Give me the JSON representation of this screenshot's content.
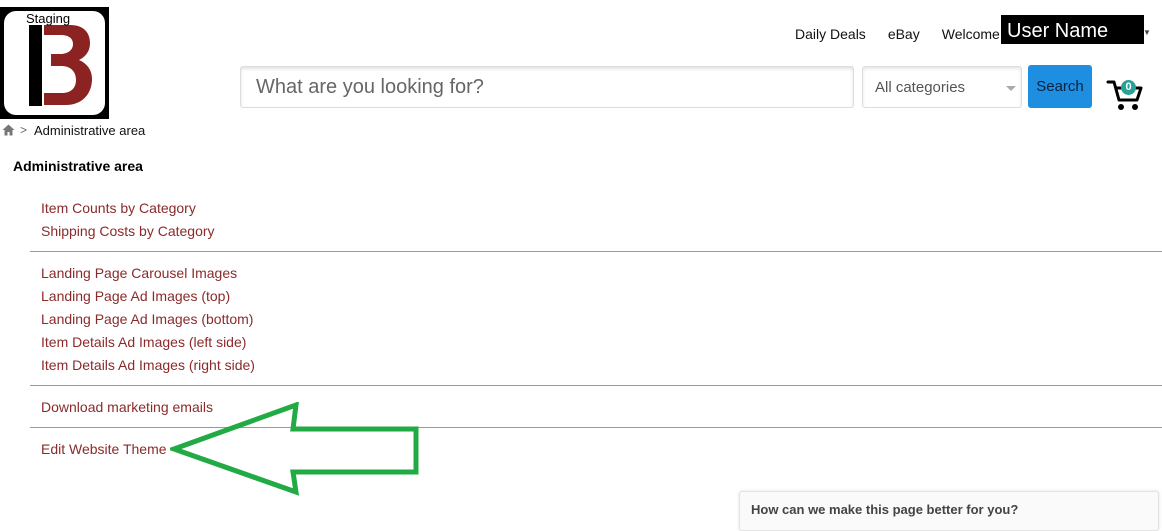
{
  "logo": {
    "badge": "Staging",
    "icon": "brand-logo-icon",
    "colors": {
      "bar": "#000000",
      "letter": "#8b2323"
    }
  },
  "topnav": {
    "daily_deals": "Daily Deals",
    "ebay": "eBay",
    "welcome": "Welcome,",
    "username": "User Name"
  },
  "search": {
    "placeholder": "What are you looking for?",
    "category": "All categories",
    "button": "Search",
    "cart_count": "0",
    "cart_icon": "shopping-cart-icon"
  },
  "breadcrumb": {
    "home_icon": "home-icon",
    "separator": ">",
    "current": "Administrative area"
  },
  "main": {
    "title": "Administrative area",
    "groups": [
      [
        "Item Counts by Category",
        "Shipping Costs by Category"
      ],
      [
        "Landing Page Carousel Images",
        "Landing Page Ad Images (top)",
        "Landing Page Ad Images (bottom)",
        "Item Details Ad Images (left side)",
        "Item Details Ad Images (right side)"
      ],
      [
        "Download marketing emails"
      ],
      [
        "Edit Website Theme"
      ]
    ]
  },
  "annotation": {
    "icon": "green-arrow-icon",
    "color": "#22aa44"
  },
  "feedback": {
    "title": "How can we make this page better for you?"
  },
  "colors": {
    "link": "#8b2a2a",
    "search_button": "#1e8fe0",
    "cart_badge": "#2aa198"
  }
}
